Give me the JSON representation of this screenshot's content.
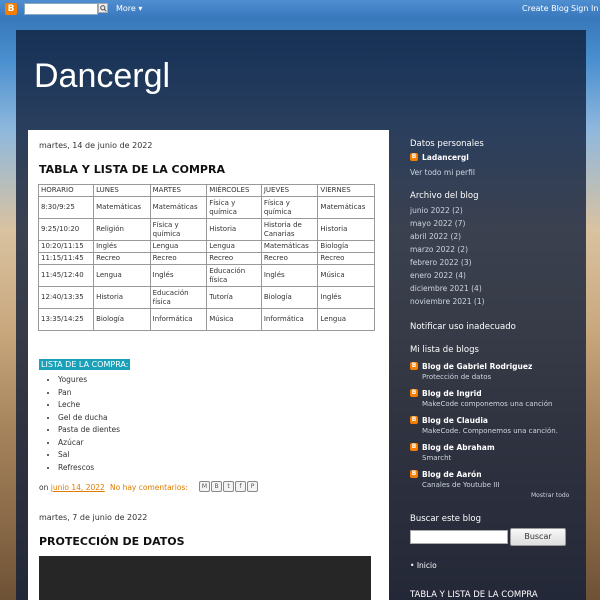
{
  "navbar": {
    "logo": "B",
    "more_label": "More ▾",
    "create_label": "Create Blog",
    "signin_label": "Sign In"
  },
  "blog": {
    "title": "Dancergl"
  },
  "post1": {
    "date": "martes, 14 de junio de 2022",
    "title": "TABLA Y LISTA DE LA COMPRA",
    "table": [
      [
        "HORARIO",
        "LUNES",
        "MARTES",
        "MIÉRCOLES",
        "JUEVES",
        "VIERNES"
      ],
      [
        "8:30/9:25",
        "Matemáticas",
        "Matemáticas",
        "Física y química",
        "Física y química",
        "Matemáticas"
      ],
      [
        "9:25/10:20",
        "Religión",
        "Física y química",
        "Historia",
        "Historia de Canarias",
        "Historia"
      ],
      [
        "10:20/11:15",
        "Inglés",
        "Lengua",
        "Lengua",
        "Matemáticas",
        "Biología"
      ],
      [
        "11:15/11:45",
        "Recreo",
        "Recreo",
        "Recreo",
        "Recreo",
        "Recreo"
      ],
      [
        "11:45/12:40",
        "Lengua",
        "Inglés",
        "Educación física",
        "Inglés",
        "Música"
      ],
      [
        "12:40/13:35",
        "Historia",
        "Educación física",
        "Tutoría",
        "Biología",
        "Inglés"
      ],
      [
        "13:35/14:25",
        "Biología",
        "Informática",
        "Música",
        "Informática",
        "Lengua"
      ]
    ],
    "list_heading": "LISTA DE LA COMPRA:",
    "list_items": [
      "Yogures",
      "Pan",
      "Leche",
      "Gel de ducha",
      "Pasta de dientes",
      "Azúcar",
      "Sal",
      "Refrescos"
    ],
    "footer_on": "on",
    "footer_date": "junio 14, 2022",
    "footer_comments": "No hay comentarios:"
  },
  "post2": {
    "date": "martes, 7 de junio de 2022",
    "title": "PROTECCIÓN DE DATOS"
  },
  "sidebar": {
    "profile_heading": "Datos personales",
    "profile_name": "Ladancergl",
    "profile_link": "Ver todo mi perfil",
    "archive_heading": "Archivo del blog",
    "archive": [
      "junio 2022 (2)",
      "mayo 2022 (7)",
      "abril 2022 (2)",
      "marzo 2022 (2)",
      "febrero 2022 (3)",
      "enero 2022 (4)",
      "diciembre 2021 (4)",
      "noviembre 2021 (1)"
    ],
    "report_heading": "Notificar uso inadecuado",
    "blogs_heading": "Mi lista de blogs",
    "blogs": [
      {
        "name": "Blog de Gabriel Rodriguez",
        "sub": "Protección de datos"
      },
      {
        "name": "Blog de Ingrid",
        "sub": "MakeCode componemos una canción"
      },
      {
        "name": "Blog de Claudia",
        "sub": "MakeCode. Componemos una canción."
      },
      {
        "name": "Blog de Abraham",
        "sub": "Smarcht"
      },
      {
        "name": "Blog de Aarón",
        "sub": "Canales de Youtube III"
      }
    ],
    "show_all": "Mostrar todo",
    "search_heading": "Buscar este blog",
    "search_button": "Buscar",
    "pages": [
      "Inicio"
    ],
    "bottom_heading": "TABLA Y LISTA DE LA COMPRA"
  },
  "colors": {
    "accent_orange": "#e07b00",
    "blogger_orange": "#f57d00",
    "list_heading_bg": "#1aa0b8"
  }
}
